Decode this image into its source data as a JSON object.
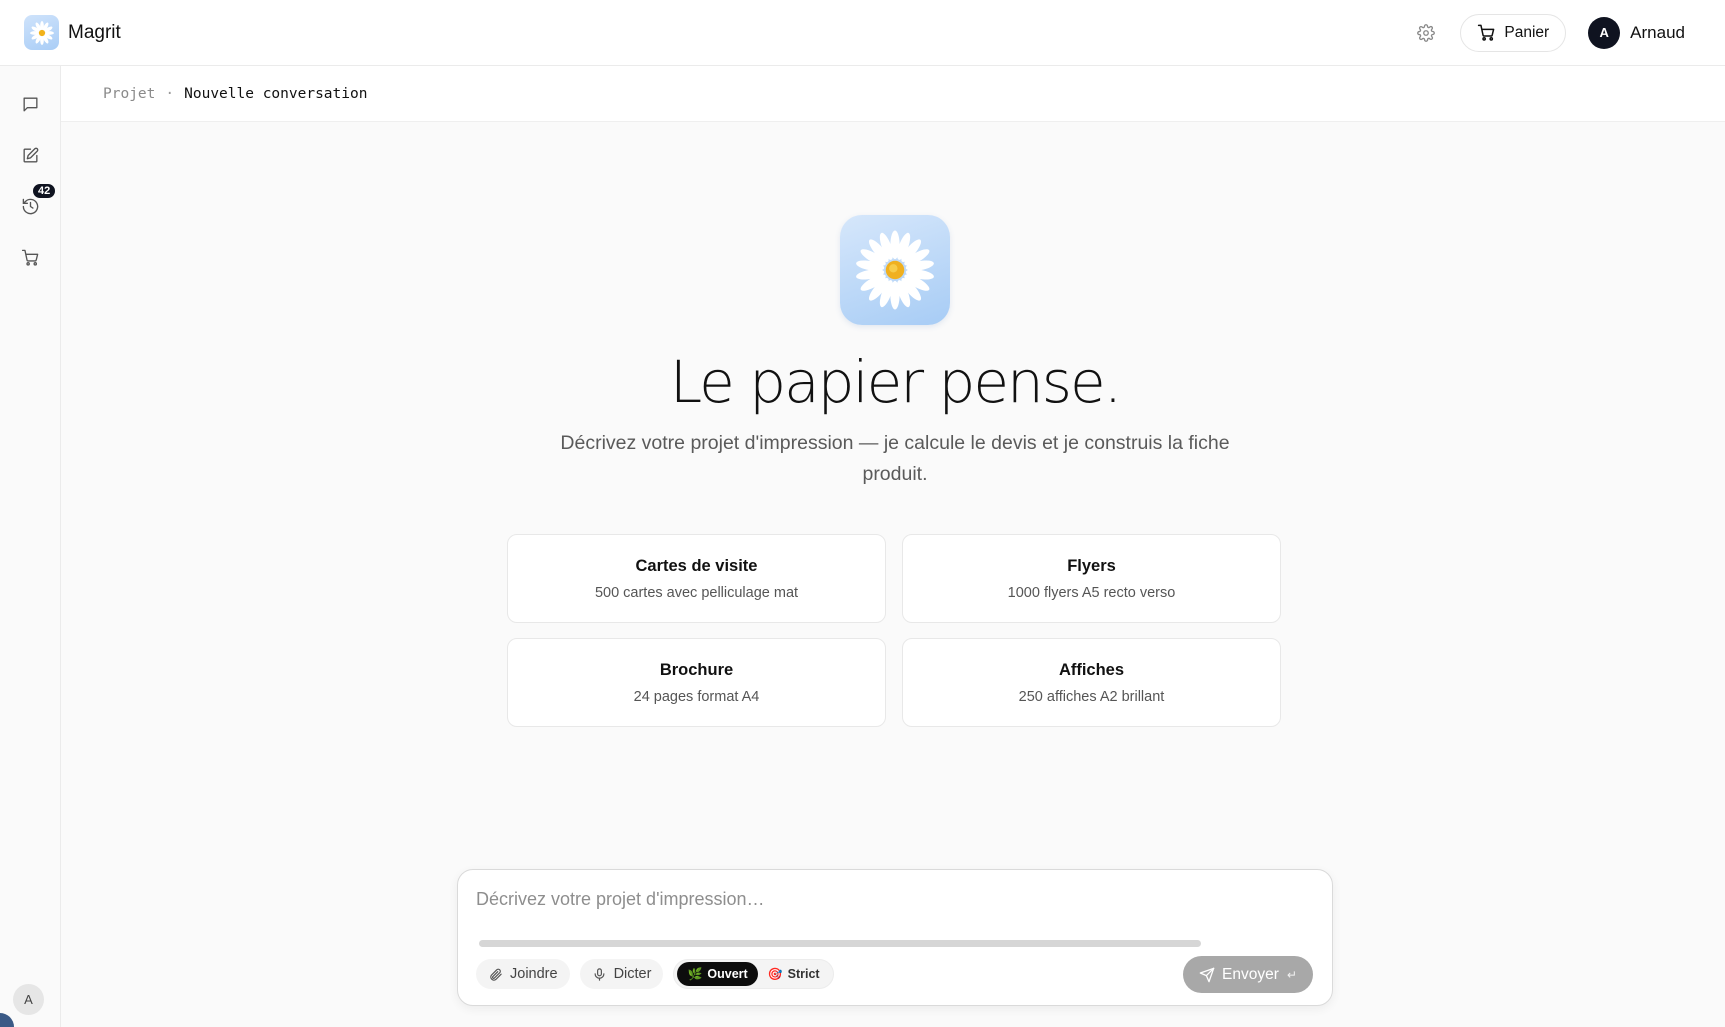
{
  "header": {
    "brand_name": "Magrit",
    "cart_label": "Panier",
    "user_initial": "A",
    "user_name": "Arnaud"
  },
  "sidebar": {
    "items": [
      {
        "icon": "chat-icon"
      },
      {
        "icon": "edit-icon"
      },
      {
        "icon": "history-icon",
        "badge": "42"
      },
      {
        "icon": "cart-icon"
      }
    ],
    "avatar_initial": "A"
  },
  "breadcrumb": {
    "parent": "Projet",
    "separator": "·",
    "current": "Nouvelle conversation"
  },
  "hero": {
    "title": "Le papier pense.",
    "subtitle": "Décrivez votre projet d'impression — je calcule le devis et je construis la fiche produit."
  },
  "suggestions": [
    {
      "title": "Cartes de visite",
      "desc": "500 cartes avec pelliculage mat"
    },
    {
      "title": "Flyers",
      "desc": "1000 flyers A5 recto verso"
    },
    {
      "title": "Brochure",
      "desc": "24 pages format A4"
    },
    {
      "title": "Affiches",
      "desc": "250 affiches A2 brillant"
    }
  ],
  "composer": {
    "placeholder": "Décrivez votre projet d'impression…",
    "attach_label": "Joindre",
    "dictate_label": "Dicter",
    "mode_open_label": "Ouvert",
    "mode_strict_label": "Strict",
    "active_mode": "Ouvert",
    "send_label": "Envoyer",
    "send_hint": "↵"
  },
  "colors": {
    "dark": "#0f1320",
    "send_disabled": "#a8a8a8",
    "logo_blue": "#a9cdf6"
  }
}
